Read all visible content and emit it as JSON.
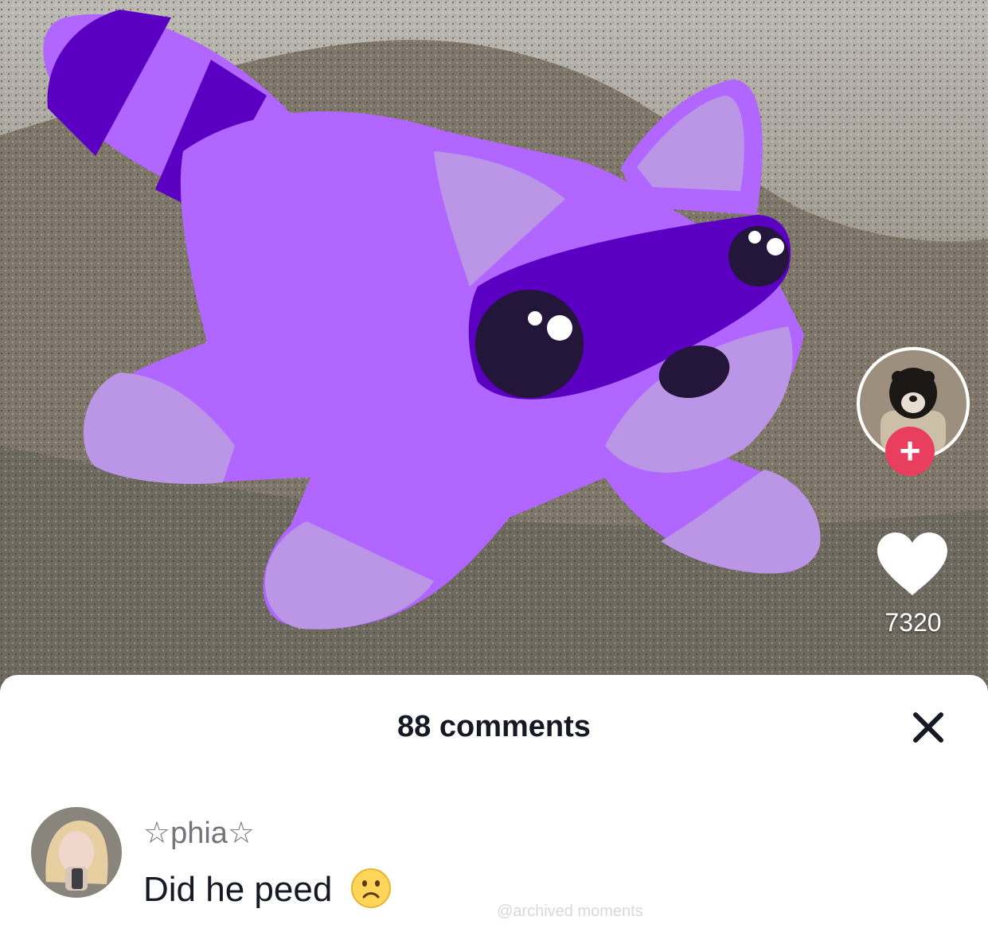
{
  "video": {
    "sticker": "purple-raccoon-plush",
    "colors": {
      "body": "#b066ff",
      "light": "#bb95e6",
      "dark": "#5b00c2",
      "eye": "#23163a"
    }
  },
  "sidebar": {
    "follow_icon": "+",
    "like_count": "7320"
  },
  "comments_sheet": {
    "title": "88 comments",
    "close_icon": "✕",
    "comment": {
      "username": "☆phia☆",
      "text": "Did he peed",
      "emoji": "slightly-frowning-face"
    },
    "watermark": "@archived moments"
  }
}
